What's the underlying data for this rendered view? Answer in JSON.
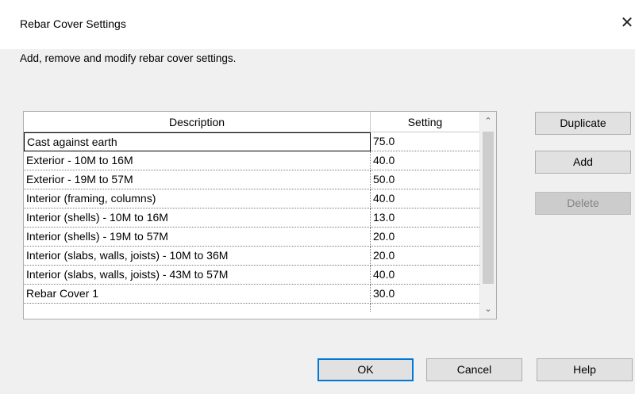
{
  "window": {
    "title": "Rebar Cover Settings",
    "close_glyph": "✕"
  },
  "instruction": "Add, remove and modify rebar cover settings.",
  "table": {
    "columns": [
      "Description",
      "Setting"
    ],
    "rows": [
      {
        "description": "Cast against earth",
        "setting": "75.0"
      },
      {
        "description": "Exterior - 10M to 16M",
        "setting": "40.0"
      },
      {
        "description": "Exterior - 19M to 57M",
        "setting": "50.0"
      },
      {
        "description": "Interior (framing, columns)",
        "setting": "40.0"
      },
      {
        "description": "Interior (shells) - 10M to 16M",
        "setting": "13.0"
      },
      {
        "description": "Interior (shells) - 19M to 57M",
        "setting": "20.0"
      },
      {
        "description": "Interior (slabs, walls, joists) - 10M to 36M",
        "setting": "20.0"
      },
      {
        "description": "Interior (slabs, walls, joists) - 43M to 57M",
        "setting": "40.0"
      },
      {
        "description": "Rebar Cover 1",
        "setting": "30.0"
      }
    ],
    "selected_row": 0
  },
  "buttons": {
    "duplicate": "Duplicate",
    "add": "Add",
    "delete": "Delete",
    "ok": "OK",
    "cancel": "Cancel",
    "help": "Help"
  },
  "colors": {
    "focus_border": "#0078d7",
    "dialog_bg": "#f0f0f0",
    "disabled_text": "#838383"
  }
}
